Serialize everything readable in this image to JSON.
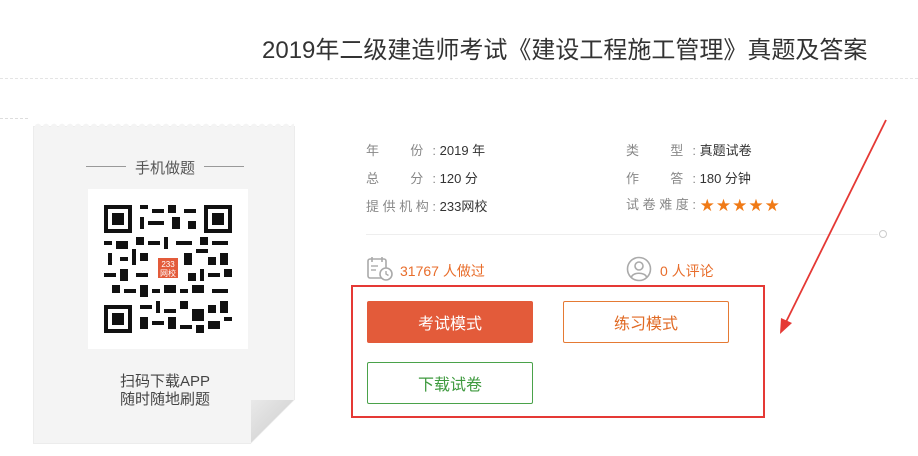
{
  "title": "2019年二级建造师考试《建设工程施工管理》真题及答案",
  "qr_card": {
    "heading": "手机做题",
    "logo_text": "233网校",
    "caption_line1": "扫码下载APP",
    "caption_line2": "随时随地刷题"
  },
  "info": {
    "year_label": "年　份:",
    "year_value": "2019 年",
    "total_label": "总　分:",
    "total_value": "120 分",
    "provider_label": "提供机构:",
    "provider_value": "233网校",
    "type_label": "类　型:",
    "type_value": "真题试卷",
    "time_label": "作　答:",
    "time_value": "180 分钟",
    "difficulty_label": "试卷难度:",
    "difficulty_stars": "★★★★★",
    "difficulty_rating": 5
  },
  "stats": {
    "done": "31767 人做过",
    "comments": "0 人评论"
  },
  "buttons": {
    "exam_mode": "考试模式",
    "practice_mode": "练习模式",
    "download": "下载试卷"
  },
  "colors": {
    "accent_orange": "#e35b3a",
    "star_orange": "#f07a16",
    "green": "#4aa24a",
    "annotation_red": "#e53935"
  }
}
